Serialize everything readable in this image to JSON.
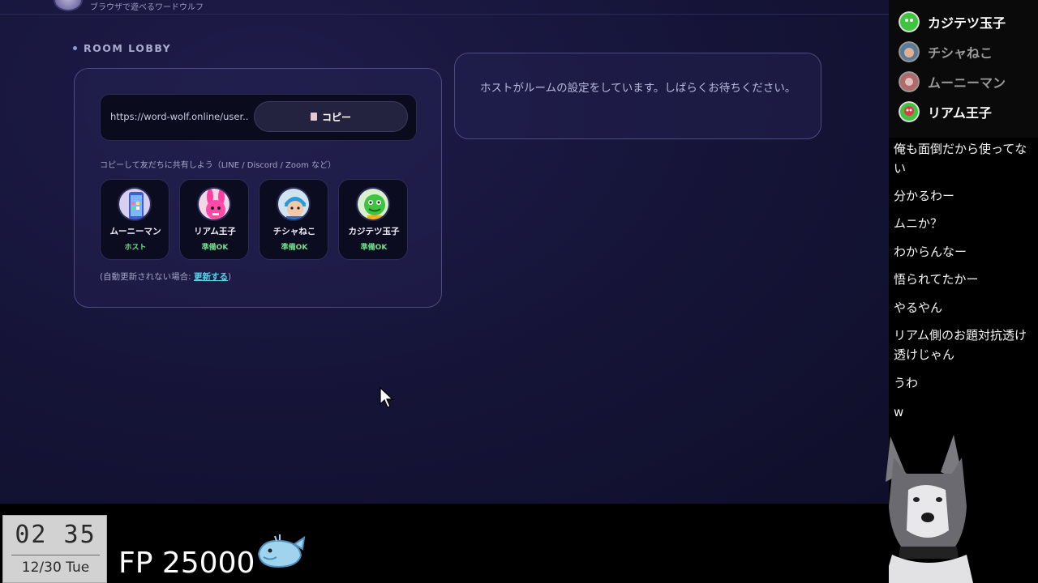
{
  "app": {
    "tagline": "ブラウザで遊べるワードウルフ",
    "section_label": "ROOM LOBBY"
  },
  "lobby": {
    "room_url": "https://word-wolf.online/user...",
    "copy_label": "コピー",
    "share_hint": "コピーして友だちに共有しよう（LINE / Discord / Zoom など）",
    "auto_update_prefix": "(自動更新されない場合: ",
    "auto_update_link": "更新する",
    "auto_update_suffix": ")",
    "players": [
      {
        "name": "ムーニーマン",
        "status": "ホスト",
        "icon": "phone-avatar"
      },
      {
        "name": "リアム王子",
        "status": "準備OK",
        "icon": "pink-rabbit-avatar"
      },
      {
        "name": "チシャねこ",
        "status": "準備OK",
        "icon": "blue-character-avatar"
      },
      {
        "name": "カジテツ玉子",
        "status": "準備OK",
        "icon": "green-dino-avatar"
      }
    ]
  },
  "host_message": "ホストがルームの設定をしています。しばらくお待ちください。",
  "viewers": [
    {
      "name": "カジテツ玉子",
      "color": "#ffffff"
    },
    {
      "name": "チシャねこ",
      "color": "#9a9a9a"
    },
    {
      "name": "ムーニーマン",
      "color": "#9a9a9a"
    },
    {
      "name": "リアム王子",
      "color": "#ffffff"
    }
  ],
  "comments": [
    "俺も面倒だから使ってない",
    "分かるわー",
    "ムニか？",
    "わからんなー",
    "悟られてたかー",
    "やるやん",
    "リアム側のお題対抗透け透けじゃん",
    "うわ",
    "w"
  ],
  "overlay": {
    "clock_time": "02 35",
    "clock_date": "12/30 Tue",
    "fp_text": "FP 25000"
  },
  "colors": {
    "accent": "#58d3e8",
    "ready": "#6fe08a",
    "panel_border": "#4b4a82"
  }
}
